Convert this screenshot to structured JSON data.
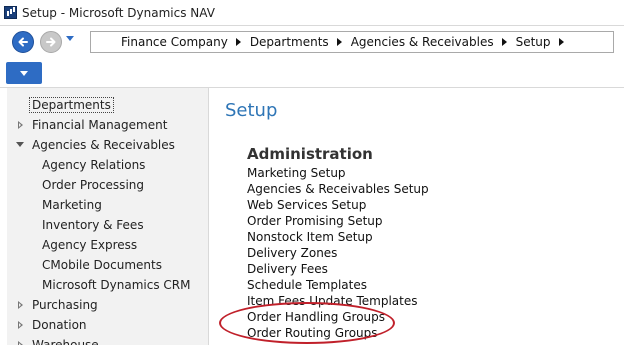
{
  "window": {
    "title": "Setup - Microsoft Dynamics NAV"
  },
  "addressbar": {
    "crumbs": [
      "Finance Company",
      "Departments",
      "Agencies & Receivables",
      "Setup"
    ]
  },
  "sidebar": {
    "items": [
      {
        "label": "Departments"
      },
      {
        "label": "Financial Management"
      },
      {
        "label": "Agencies & Receivables"
      },
      {
        "label": "Agency Relations"
      },
      {
        "label": "Order Processing"
      },
      {
        "label": "Marketing"
      },
      {
        "label": "Inventory & Fees"
      },
      {
        "label": "Agency Express"
      },
      {
        "label": "CMobile Documents"
      },
      {
        "label": "Microsoft Dynamics CRM"
      },
      {
        "label": "Purchasing"
      },
      {
        "label": "Donation"
      },
      {
        "label": "Warehouse"
      }
    ]
  },
  "main": {
    "title": "Setup",
    "section": "Administration",
    "links": [
      "Marketing Setup",
      "Agencies & Receivables Setup",
      "Web Services Setup",
      "Order Promising Setup",
      "Nonstock Item Setup",
      "Delivery Zones",
      "Delivery Fees",
      "Schedule Templates",
      "Item Fees Update Templates",
      "Order Handling Groups",
      "Order Routing Groups"
    ]
  },
  "colors": {
    "accent": "#2e6cc4",
    "page_title": "#2e75b6",
    "annotation": "#c0202a"
  }
}
